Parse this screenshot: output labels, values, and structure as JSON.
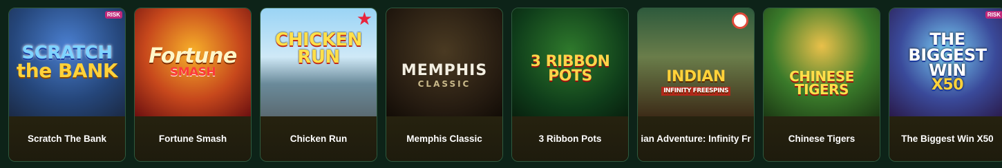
{
  "games": [
    {
      "label": "Scratch The Bank",
      "art_title": "SCRATCH",
      "art_sub": "the BANK",
      "badge": "RISK"
    },
    {
      "label": "Fortune Smash",
      "art_title": "Fortune",
      "art_sub": "SMASH",
      "badge": ""
    },
    {
      "label": "Chicken Run",
      "art_title": "CHICKEN RUN",
      "art_sub": "",
      "badge": ""
    },
    {
      "label": "Memphis Classic",
      "art_title": "MEMPHIS",
      "art_sub": "CLASSIC",
      "badge": ""
    },
    {
      "label": "3 Ribbon Pots",
      "art_title": "3 RIBBON POTS",
      "art_sub": "",
      "badge": ""
    },
    {
      "label": "ian Adventure: Infinity Fr",
      "art_title": "INDIAN",
      "art_sub": "INFINITY FREESPINS",
      "badge": ""
    },
    {
      "label": "Chinese Tigers",
      "art_title": "CHINESE TIGERS",
      "art_sub": "",
      "badge": ""
    },
    {
      "label": "The Biggest Win X50",
      "art_title": "THE BIGGEST WIN",
      "art_sub": "X50",
      "badge": "RISK"
    }
  ],
  "colors": {
    "background": "#0d2318",
    "card_border": "#2f5a3e",
    "label_bg": "#26220f",
    "label_text": "#ffffff"
  }
}
